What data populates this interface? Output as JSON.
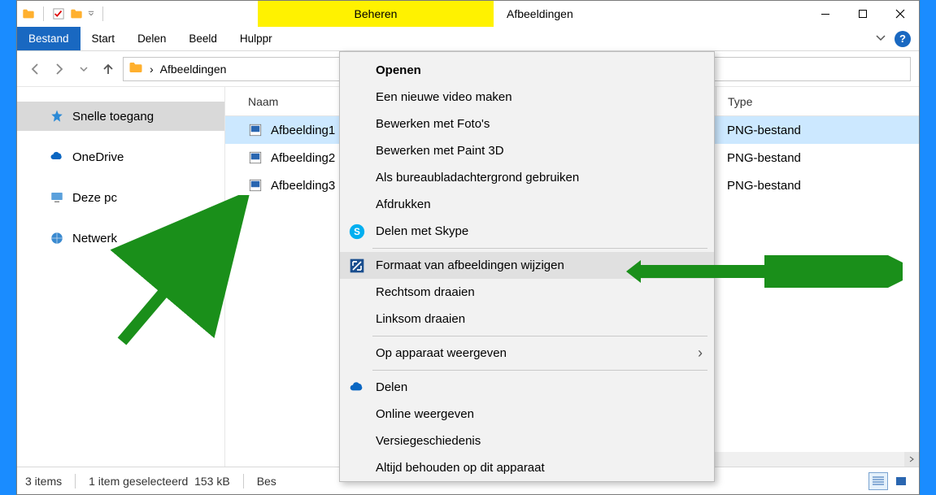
{
  "window": {
    "contextual_tab": "Beheren",
    "title": "Afbeeldingen"
  },
  "ribbon": {
    "file": "Bestand",
    "tabs": [
      "Start",
      "Delen",
      "Beeld",
      "Hulppr"
    ]
  },
  "address": {
    "crumb_sep": "›",
    "location": "Afbeeldingen"
  },
  "sidebar": {
    "items": [
      {
        "icon": "star",
        "label": "Snelle toegang",
        "selected": true
      },
      {
        "icon": "onedrive",
        "label": "OneDrive"
      },
      {
        "icon": "pc",
        "label": "Deze pc"
      },
      {
        "icon": "network",
        "label": "Netwerk"
      }
    ]
  },
  "columns": {
    "name": "Naam",
    "type": "Type"
  },
  "files": [
    {
      "name": "Afbeelding1",
      "type": "PNG-bestand",
      "selected": true
    },
    {
      "name": "Afbeelding2",
      "type": "PNG-bestand"
    },
    {
      "name": "Afbeelding3",
      "type": "PNG-bestand"
    }
  ],
  "context_menu": {
    "items": [
      {
        "label": "Openen",
        "bold": true
      },
      {
        "label": "Een nieuwe video maken"
      },
      {
        "label": "Bewerken met Foto's"
      },
      {
        "label": "Bewerken met Paint 3D"
      },
      {
        "label": "Als bureaubladachtergrond gebruiken"
      },
      {
        "label": "Afdrukken"
      },
      {
        "label": "Delen met Skype",
        "icon": "skype"
      },
      {
        "sep": true
      },
      {
        "label": "Formaat van afbeeldingen wijzigen",
        "icon": "resize",
        "hover": true
      },
      {
        "label": "Rechtsom draaien"
      },
      {
        "label": "Linksom draaien"
      },
      {
        "sep": true
      },
      {
        "label": "Op apparaat weergeven",
        "submenu": true
      },
      {
        "sep": true
      },
      {
        "label": "Delen",
        "icon": "onedrive"
      },
      {
        "label": "Online weergeven"
      },
      {
        "label": "Versiegeschiedenis"
      },
      {
        "label": "Altijd behouden op dit apparaat"
      }
    ]
  },
  "status": {
    "count": "3 items",
    "selection": "1 item geselecteerd",
    "size": "153 kB",
    "extra": "Bes"
  }
}
